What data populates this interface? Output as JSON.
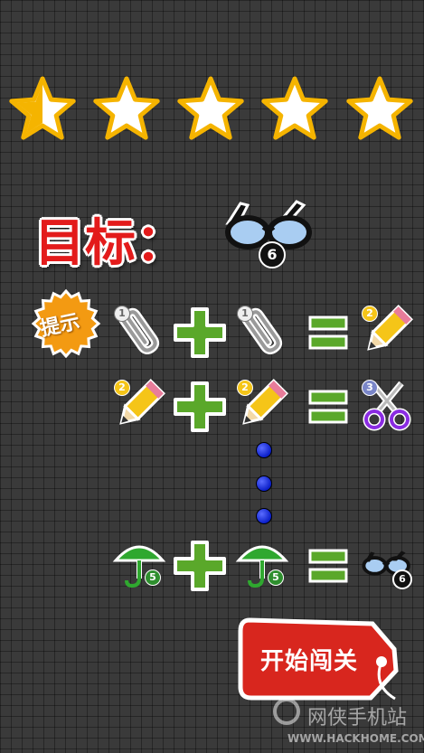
{
  "rating": {
    "level": 0.5,
    "max": 5
  },
  "goal": {
    "label": "目标：",
    "item_icon": "glasses-icon",
    "item_count": "6"
  },
  "hint": {
    "badge_label": "提示",
    "recipes": [
      {
        "left_icon": "paperclip-icon",
        "left_level": "1",
        "right_icon": "paperclip-icon",
        "right_level": "1",
        "result_icon": "pencil-icon",
        "result_level": "2"
      },
      {
        "left_icon": "pencil-icon",
        "left_level": "2",
        "right_icon": "pencil-icon",
        "right_level": "2",
        "result_icon": "scissors-icon",
        "result_level": "3"
      },
      {
        "left_icon": "umbrella-icon",
        "left_level": "5",
        "right_icon": "umbrella-icon",
        "right_level": "5",
        "result_icon": "glasses-icon",
        "result_level": "6"
      }
    ]
  },
  "start_button": {
    "label": "开始闯关"
  },
  "watermark": {
    "brand": "网侠手机站",
    "url": "WWW.HACKHOME.COM"
  },
  "colors": {
    "accent_red": "#d8261e",
    "plus_green": "#5aa82a",
    "star_gold": "#f5b400"
  }
}
